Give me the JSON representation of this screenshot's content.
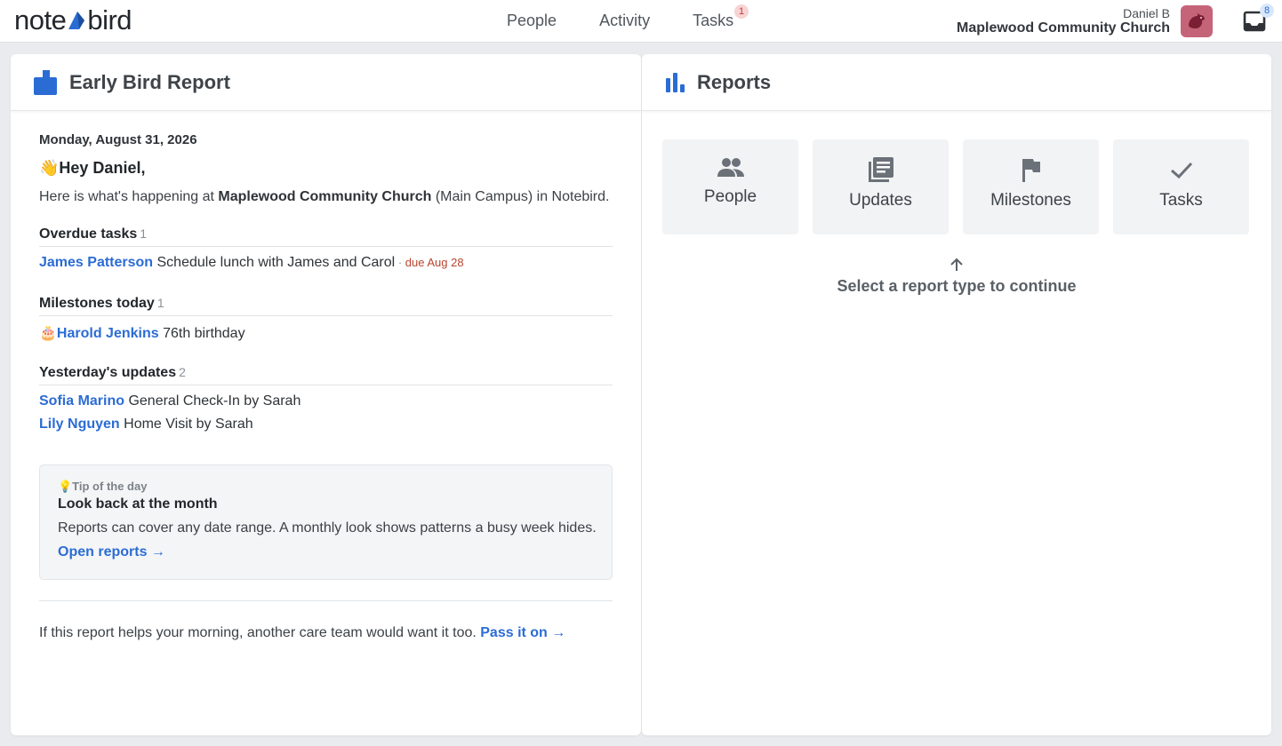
{
  "brand": {
    "logo_left": "note",
    "logo_right": "bird"
  },
  "nav": {
    "items": [
      {
        "label": "People"
      },
      {
        "label": "Activity"
      },
      {
        "label": "Tasks",
        "badge": "1"
      }
    ]
  },
  "user": {
    "name": "Daniel B",
    "org": "Maplewood Community Church"
  },
  "inbox": {
    "badge": "8"
  },
  "report": {
    "title": "Early Bird Report",
    "date": "Monday, August 31, 2026",
    "greeting": "👋Hey Daniel,",
    "intro_pre": "Here is what's happening at ",
    "intro_org": "Maplewood Community Church",
    "intro_post": " (Main Campus) in Notebird.",
    "overdue": {
      "heading": "Overdue tasks",
      "count": "1",
      "items": [
        {
          "person": "James Patterson",
          "text": " Schedule lunch with James and Carol",
          "sep": " · ",
          "due": "due Aug 28"
        }
      ]
    },
    "milestones": {
      "heading": "Milestones today",
      "count": "1",
      "items": [
        {
          "emoji": "🎂",
          "person": "Harold Jenkins",
          "text": " 76th birthday"
        }
      ]
    },
    "updates": {
      "heading": "Yesterday's updates",
      "count": "2",
      "items": [
        {
          "person": "Sofia Marino",
          "text": " General Check-In by Sarah"
        },
        {
          "person": "Lily Nguyen",
          "text": " Home Visit by Sarah"
        }
      ]
    },
    "tip": {
      "label": "💡Tip of the day",
      "title": "Look back at the month",
      "body": "Reports can cover any date range. A monthly look shows patterns a busy week hides.",
      "link": "Open reports →"
    },
    "footer_text": "If this report helps your morning, another care team would want it too. ",
    "footer_link": "Pass it on →"
  },
  "reports": {
    "title": "Reports",
    "cards": [
      {
        "label": "People",
        "icon": "people-icon"
      },
      {
        "label": "Updates",
        "icon": "updates-icon"
      },
      {
        "label": "Milestones",
        "icon": "flag-icon"
      },
      {
        "label": "Tasks",
        "icon": "check-icon"
      }
    ],
    "hint": "Select a report type to continue"
  },
  "colors": {
    "accent": "#2b6cd4",
    "due": "#b8442f",
    "avatar": "#c56479"
  }
}
